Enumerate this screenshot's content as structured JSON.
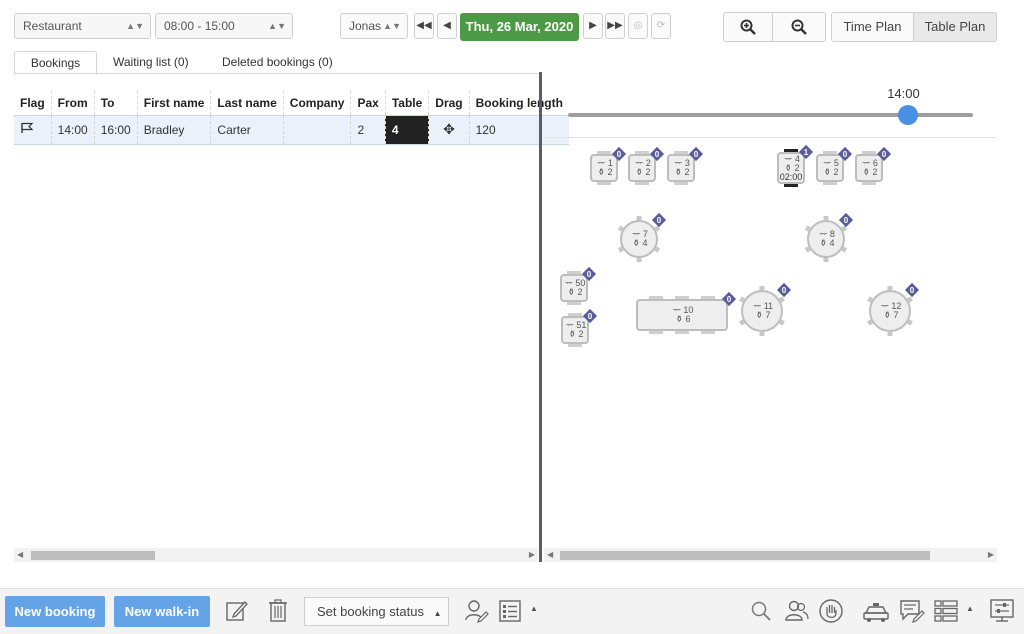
{
  "toolbar": {
    "venue": "Restaurant",
    "time_range": "08:00 - 15:00",
    "user": "Jonas",
    "date": "Thu, 26 Mar, 2020",
    "time_plan_label": "Time Plan",
    "table_plan_label": "Table Plan"
  },
  "tabs": [
    {
      "label": "Bookings"
    },
    {
      "label": "Waiting list (0)"
    },
    {
      "label": "Deleted bookings (0)"
    }
  ],
  "grid": {
    "columns": [
      "Flag",
      "From",
      "To",
      "First name",
      "Last name",
      "Company",
      "Pax",
      "Table",
      "Drag",
      "Booking length"
    ],
    "rows": [
      {
        "from": "14:00",
        "to": "16:00",
        "first_name": "Bradley",
        "last_name": "Carter",
        "company": "",
        "pax": "2",
        "table": "4",
        "booking_length": "120"
      }
    ]
  },
  "slider": {
    "time_label": "14:00",
    "position_fraction": 0.84
  },
  "tables": [
    {
      "name": "1",
      "seats": "2",
      "badge": "0"
    },
    {
      "name": "2",
      "seats": "2",
      "badge": "0"
    },
    {
      "name": "3",
      "seats": "2",
      "badge": "0"
    },
    {
      "name": "4",
      "seats": "2",
      "badge": "1",
      "time": "02:00"
    },
    {
      "name": "5",
      "seats": "2",
      "badge": "0"
    },
    {
      "name": "6",
      "seats": "2",
      "badge": "0"
    },
    {
      "name": "7",
      "seats": "4",
      "badge": "0"
    },
    {
      "name": "8",
      "seats": "4",
      "badge": "0"
    },
    {
      "name": "50",
      "seats": "2",
      "badge": "0"
    },
    {
      "name": "51",
      "seats": "2",
      "badge": "0"
    },
    {
      "name": "10",
      "seats": "6",
      "badge": "0"
    },
    {
      "name": "11",
      "seats": "7",
      "badge": "0"
    },
    {
      "name": "12",
      "seats": "7",
      "badge": "0"
    }
  ],
  "bottom": {
    "new_booking": "New booking",
    "new_walkin": "New walk-in",
    "set_status": "Set booking status"
  },
  "colors": {
    "date_green": "#4c9a45",
    "primary_blue": "#64a4e6",
    "badge_purple": "#5c5b9e",
    "selected_table": "#222222"
  }
}
